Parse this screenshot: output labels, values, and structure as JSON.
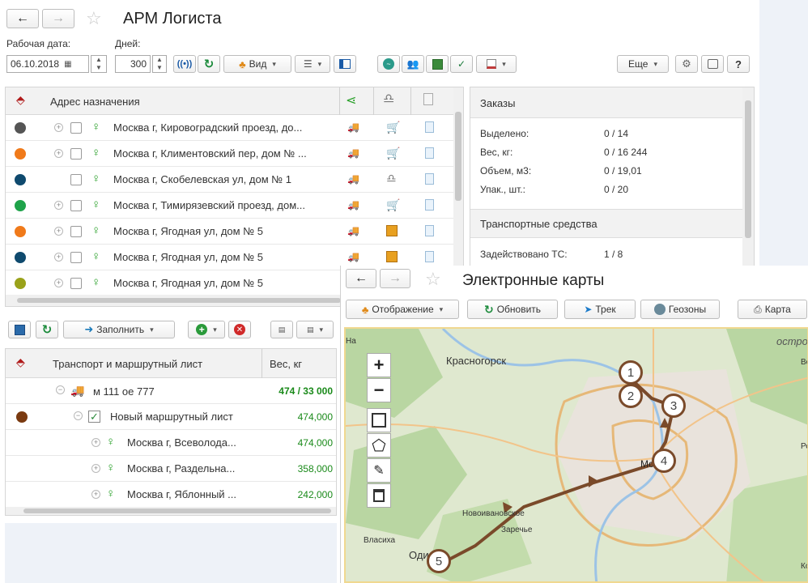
{
  "app": {
    "title": "АРМ Логиста",
    "work_date_label": "Рабочая дата:",
    "work_date_value": "06.10.2018",
    "days_label": "Дней:",
    "days_value": "300",
    "view_label": "Вид",
    "more_label": "Еще",
    "help_label": "?"
  },
  "orders_table": {
    "col_address": "Адрес назначения",
    "rows": [
      {
        "color": "#555555",
        "address": "Москва г, Кировоградский проезд, до...",
        "has_plus": true
      },
      {
        "color": "#f07a1a",
        "address": "Москва г, Климентовский пер, дом № ...",
        "has_plus": true
      },
      {
        "color": "#0f4a6e",
        "address": "Москва г, Скобелевская ул, дом № 1",
        "has_plus": false
      },
      {
        "color": "#1fa34a",
        "address": "Москва г, Тимирязевский проезд, дом...",
        "has_plus": true
      },
      {
        "color": "#f07a1a",
        "address": "Москва г, Ягодная ул, дом № 5",
        "has_plus": true
      },
      {
        "color": "#0f4a6e",
        "address": "Москва г, Ягодная ул, дом № 5",
        "has_plus": true
      },
      {
        "color": "#9aa21a",
        "address": "Москва г, Ягодная ул, дом № 5",
        "has_plus": true
      }
    ]
  },
  "summary": {
    "orders_title": "Заказы",
    "selected_label": "Выделено:",
    "selected_value": "0 / 14",
    "weight_label": "Вес, кг:",
    "weight_value": "0 / 16 244",
    "volume_label": "Объем, м3:",
    "volume_value": "0 / 19,01",
    "packs_label": "Упак., шт.:",
    "packs_value": "0 / 20",
    "vehicles_title": "Транспортные средства",
    "used_label": "Задействовано ТС:",
    "used_value": "1 / 8"
  },
  "transport": {
    "fill_label": "Заполнить",
    "col_transport": "Транспорт и маршрутный лист",
    "col_weight": "Вес, кг",
    "vehicle": {
      "name": "м 111 ое 777",
      "weight": "474 / 33 000"
    },
    "route_sheet": {
      "color": "#7a3a10",
      "name": "Новый маршрутный лист",
      "weight": "474,000"
    },
    "stops": [
      {
        "address": "Москва г, Всеволода...",
        "weight": "474,000"
      },
      {
        "address": "Москва г, Раздельна...",
        "weight": "358,000"
      },
      {
        "address": "Москва г, Яблонный ...",
        "weight": "242,000"
      }
    ]
  },
  "map_window": {
    "title": "Электронные карты",
    "display_label": "Отображение",
    "refresh_label": "Обновить",
    "track_label": "Трек",
    "geozones_label": "Геозоны",
    "map_label": "Карта",
    "zoom_in": "+",
    "zoom_out": "−",
    "places": {
      "krasnogorsk": "Красногорск",
      "moskva": "Москва",
      "novoivanovskoe": "Новоивановское",
      "zarechye": "Заречье",
      "vlasikha": "Власиха",
      "odin": "Оди",
      "ostrov": "остров",
      "edge_na": "На",
      "edge_vo": "Во",
      "edge_re": "Ре",
      "edge_ko": "Ко"
    },
    "markers": [
      "1",
      "2",
      "3",
      "4",
      "5"
    ],
    "route_color": "#7a4a2a"
  }
}
